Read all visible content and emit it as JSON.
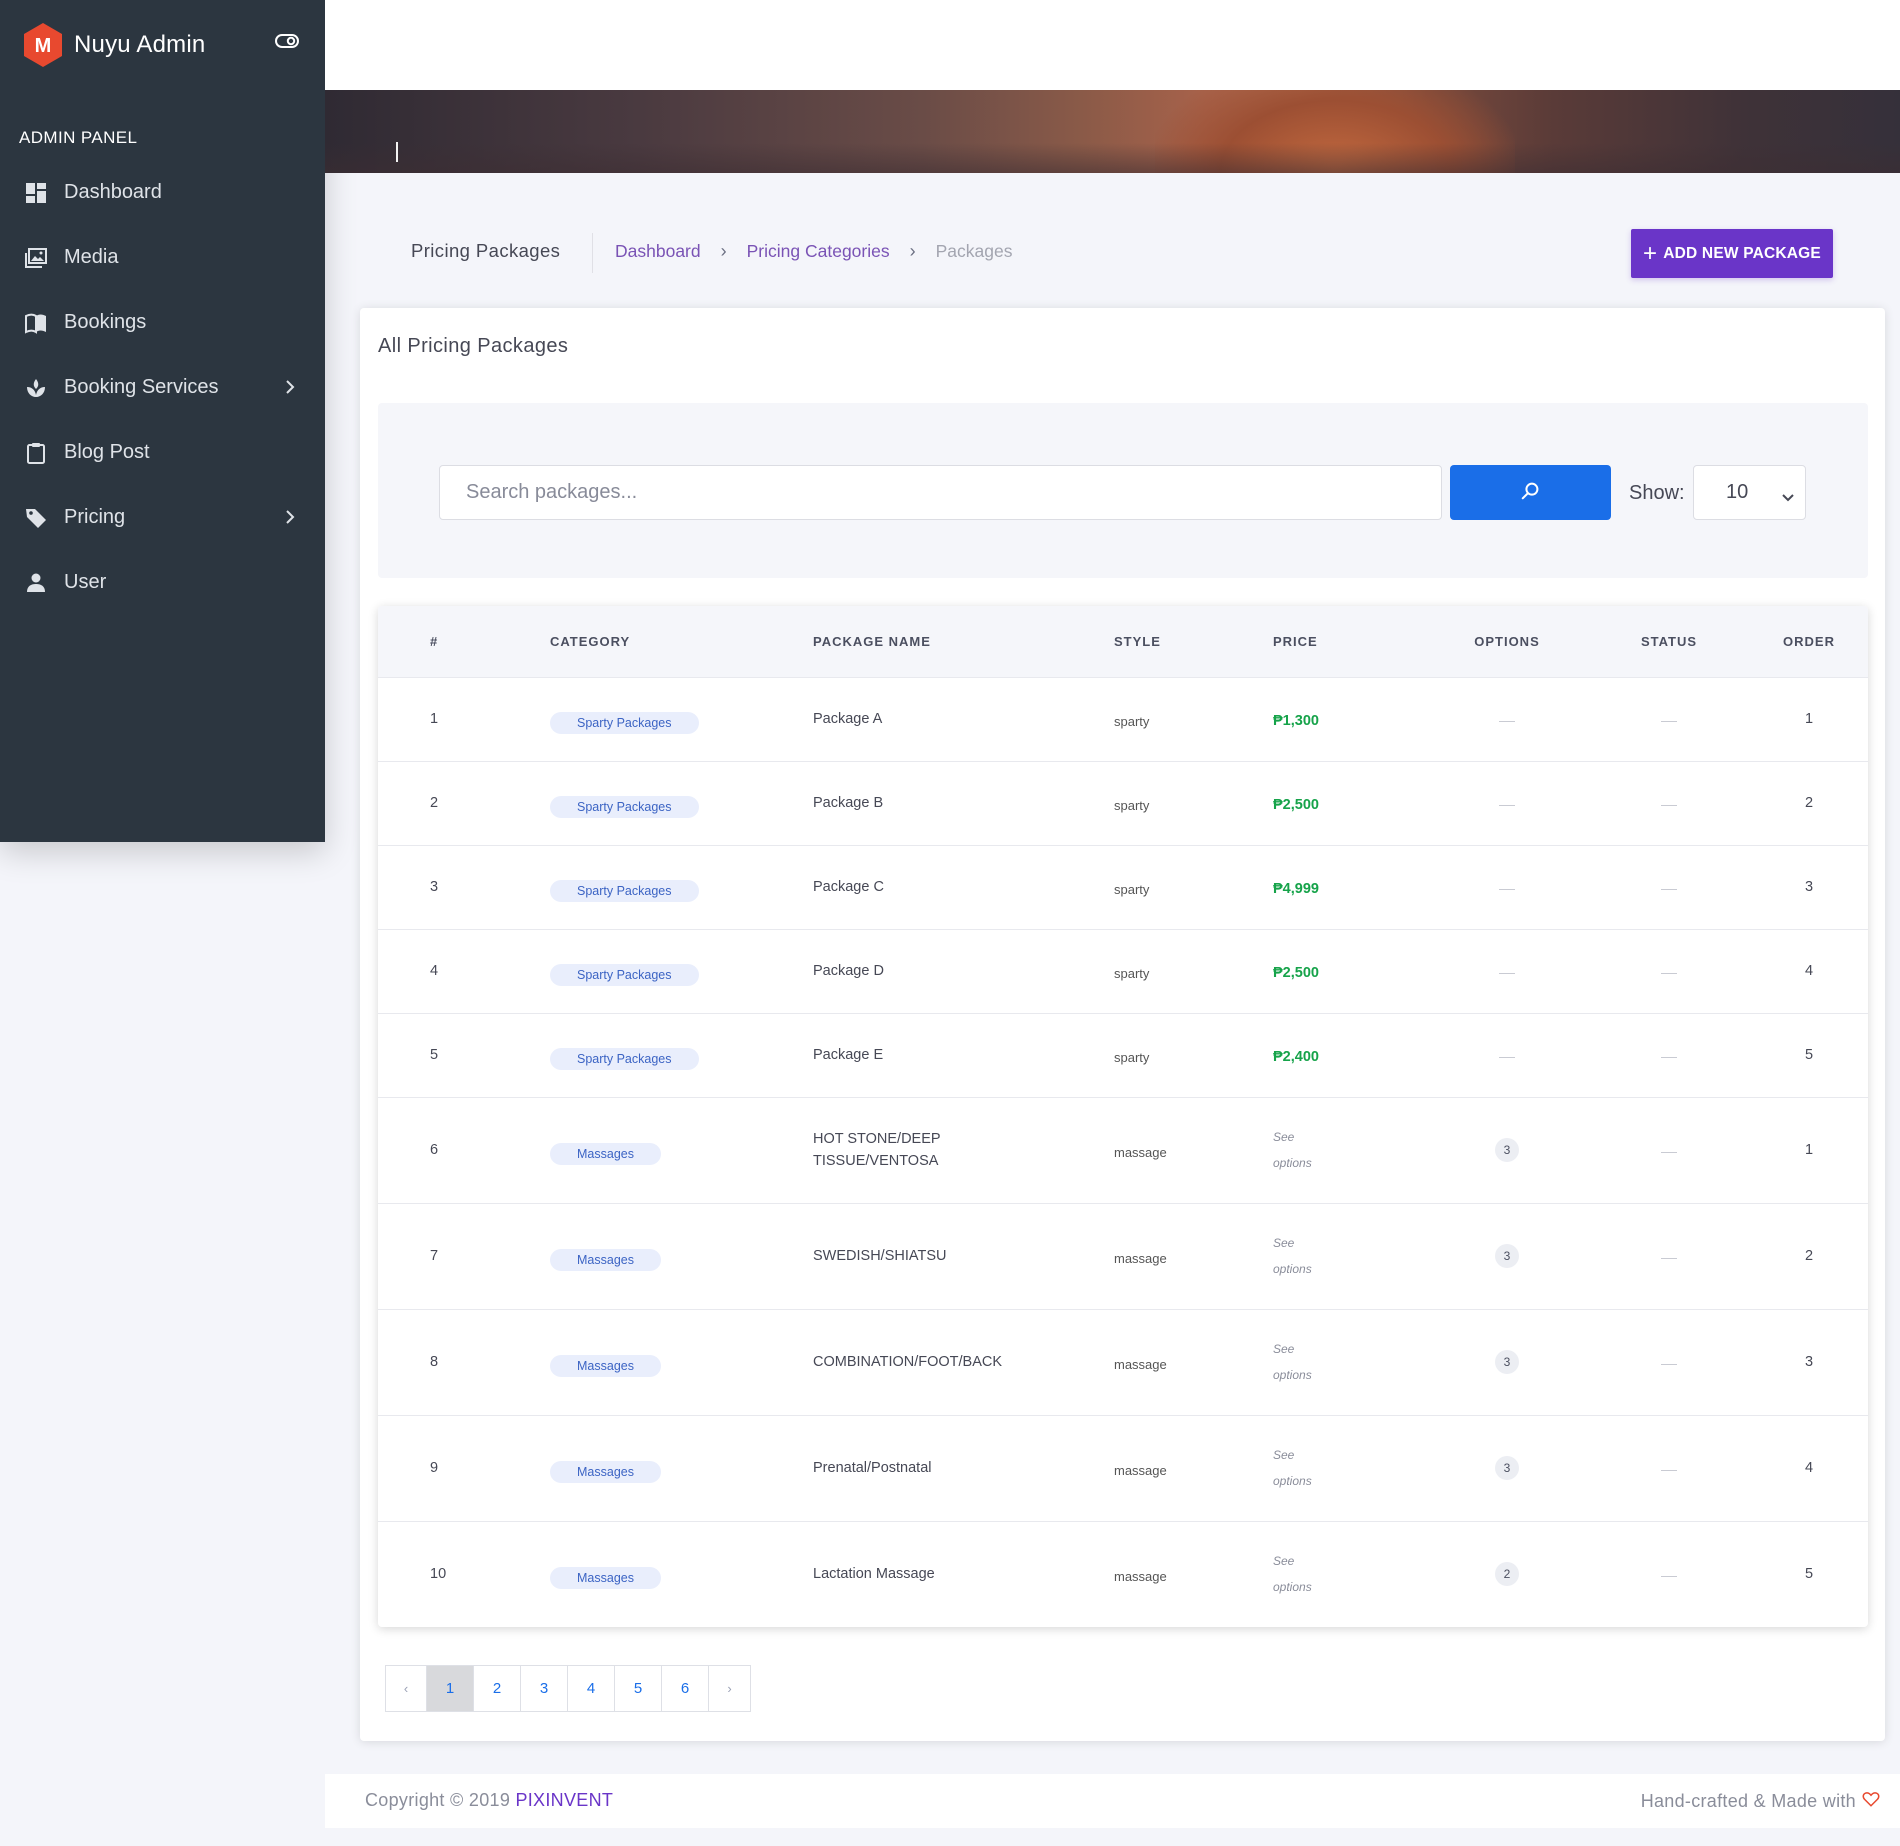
{
  "sidebar": {
    "brand": "Nuyu Admin",
    "brand_letter": "M",
    "section_title": "ADMIN PANEL",
    "items": [
      {
        "label": "Dashboard",
        "icon": "dashboard-icon"
      },
      {
        "label": "Media",
        "icon": "media-icon"
      },
      {
        "label": "Bookings",
        "icon": "book-icon"
      },
      {
        "label": "Booking Services",
        "icon": "services-icon",
        "has_submenu": true
      },
      {
        "label": "Blog Post",
        "icon": "clipboard-icon"
      },
      {
        "label": "Pricing",
        "icon": "tag-icon",
        "has_submenu": true
      },
      {
        "label": "User",
        "icon": "user-icon"
      }
    ]
  },
  "header": {
    "title": "Pricing Packages",
    "breadcrumb": [
      "Dashboard",
      "Pricing Categories",
      "Packages"
    ],
    "add_button": "ADD NEW PACKAGE"
  },
  "card": {
    "title": "All Pricing Packages",
    "search_placeholder": "Search packages...",
    "show_label": "Show:",
    "show_value": "10"
  },
  "table": {
    "columns": [
      "#",
      "CATEGORY",
      "PACKAGE NAME",
      "STYLE",
      "PRICE",
      "OPTIONS",
      "STATUS",
      "ORDER"
    ],
    "rows": [
      {
        "num": "1",
        "category": "Sparty Packages",
        "name": "Package A",
        "style": "sparty",
        "price": "₱1,300",
        "options": "",
        "order": "1"
      },
      {
        "num": "2",
        "category": "Sparty Packages",
        "name": "Package B",
        "style": "sparty",
        "price": "₱2,500",
        "options": "",
        "order": "2"
      },
      {
        "num": "3",
        "category": "Sparty Packages",
        "name": "Package C",
        "style": "sparty",
        "price": "₱4,999",
        "options": "",
        "order": "3"
      },
      {
        "num": "4",
        "category": "Sparty Packages",
        "name": "Package D",
        "style": "sparty",
        "price": "₱2,500",
        "options": "",
        "order": "4"
      },
      {
        "num": "5",
        "category": "Sparty Packages",
        "name": "Package E",
        "style": "sparty",
        "price": "₱2,400",
        "options": "",
        "order": "5"
      },
      {
        "num": "6",
        "category": "Massages",
        "name_lines": [
          "HOT STONE/DEEP",
          "TISSUE/VENTOSA"
        ],
        "style": "massage",
        "price_lines": [
          "See",
          "options"
        ],
        "options": "3",
        "order": "1"
      },
      {
        "num": "7",
        "category": "Massages",
        "name": "SWEDISH/SHIATSU",
        "style": "massage",
        "price_lines": [
          "See",
          "options"
        ],
        "options": "3",
        "order": "2"
      },
      {
        "num": "8",
        "category": "Massages",
        "name": "COMBINATION/FOOT/BACK",
        "style": "massage",
        "price_lines": [
          "See",
          "options"
        ],
        "options": "3",
        "order": "3"
      },
      {
        "num": "9",
        "category": "Massages",
        "name": "Prenatal/Postnatal",
        "style": "massage",
        "price_lines": [
          "See",
          "options"
        ],
        "options": "3",
        "order": "4"
      },
      {
        "num": "10",
        "category": "Massages",
        "name": "Lactation Massage",
        "style": "massage",
        "price_lines": [
          "See",
          "options"
        ],
        "options": "2",
        "order": "5"
      }
    ]
  },
  "pagination": {
    "prev": "‹",
    "next": "›",
    "pages": [
      "1",
      "2",
      "3",
      "4",
      "5",
      "6"
    ],
    "current": "1"
  },
  "footer": {
    "copyright": "Copyright © 2019 ",
    "company": "PIXINVENT",
    "made_with": "Hand-crafted & Made with"
  },
  "colors": {
    "sidebar_bg": "#2c3640",
    "accent": "#6a35c8",
    "search_button": "#1a6ee8",
    "price_green": "#16a34a",
    "logo": "#e74c3c"
  }
}
